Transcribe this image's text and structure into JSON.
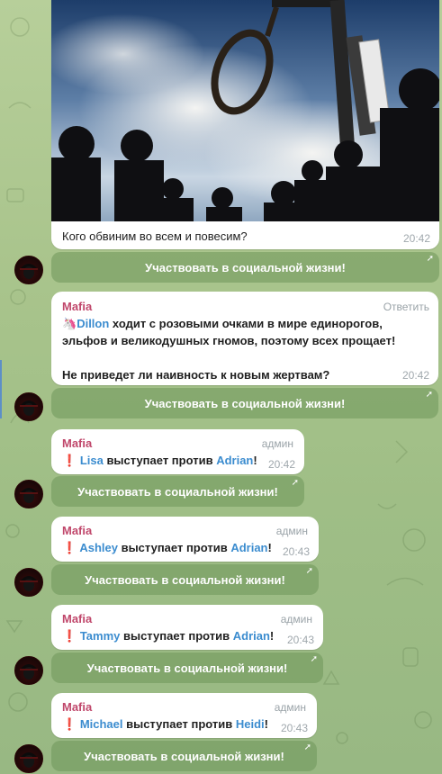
{
  "messages": [
    {
      "caption": "Кого обвиним во всем и повесим?",
      "time": "20:42",
      "button": "Участвовать в социальной жизни!"
    },
    {
      "sender": "Mafia",
      "reply_label": "Ответить",
      "emoji": "🦄",
      "name": "Dillon",
      "line1": " ходит с розовыми очками в мире единорогов,",
      "line2": "эльфов и великодушных гномов, поэтому всех прощает!",
      "line3": "Не приведет ли наивность к новым жертвам?",
      "time": "20:42",
      "button": "Участвовать в социальной жизни!"
    },
    {
      "sender": "Mafia",
      "tag": "админ",
      "bang": "❗",
      "name1": "Lisa",
      "mid": " выступает против ",
      "name2": "Adrian",
      "end": "!",
      "time": "20:42",
      "button": "Участвовать в социальной жизни!"
    },
    {
      "sender": "Mafia",
      "tag": "админ",
      "bang": "❗",
      "name1": "Ashley",
      "mid": " выступает против ",
      "name2": "Adrian",
      "end": "!",
      "time": "20:43",
      "button": "Участвовать в социальной жизни!"
    },
    {
      "sender": "Mafia",
      "tag": "админ",
      "bang": "❗",
      "name1": "Tammy",
      "mid": " выступает против ",
      "name2": "Adrian",
      "end": "!",
      "time": "20:43",
      "button": "Участвовать в социальной жизни!"
    },
    {
      "sender": "Mafia",
      "tag": "админ",
      "bang": "❗",
      "name1": "Michael",
      "mid": " выступает против ",
      "name2": "Heidi",
      "end": "!",
      "time": "20:43",
      "button": "Участвовать в социальной жизни!"
    }
  ],
  "icons": {
    "button_arrow": "arrow-up-right-icon",
    "avatar": "mafia-avatar-icon"
  }
}
